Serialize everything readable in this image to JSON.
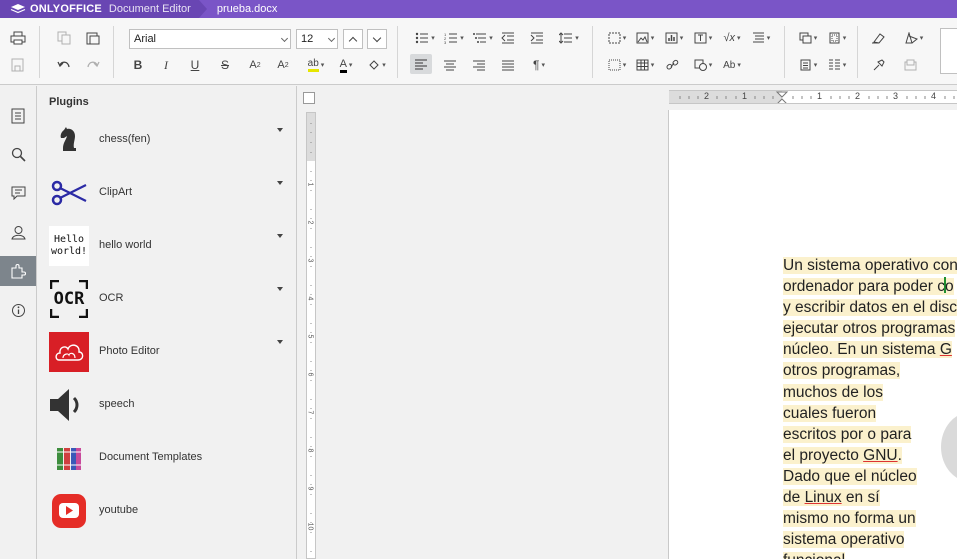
{
  "titlebar": {
    "brand": "ONLYOFFICE",
    "app": "Document Editor",
    "document": "prueba.docx",
    "color": "#7a55c7"
  },
  "toolbar": {
    "font_name": "Arial",
    "font_size": "12",
    "paragraph_mark": "¶",
    "clear_style": "Aa",
    "case_label": "Ab"
  },
  "sidebar": {
    "items": [
      {
        "icon": "document-icon"
      },
      {
        "icon": "search-icon"
      },
      {
        "icon": "comment-icon"
      },
      {
        "icon": "user-icon"
      },
      {
        "icon": "plugins-icon",
        "active": true
      },
      {
        "icon": "info-icon"
      }
    ]
  },
  "plugins": {
    "title": "Plugins",
    "items": [
      {
        "name": "chess(fen)",
        "icon": "chess-knight-icon",
        "has_menu": true
      },
      {
        "name": "ClipArt",
        "icon": "scissors-icon",
        "has_menu": true
      },
      {
        "name": "hello world",
        "icon": "hello-world-icon",
        "icon_text": "Hello\nworld!",
        "has_menu": true
      },
      {
        "name": "OCR",
        "icon": "ocr-icon",
        "icon_text": "OCR",
        "has_menu": true
      },
      {
        "name": "Photo Editor",
        "icon": "photo-editor-icon",
        "has_menu": true
      },
      {
        "name": "speech",
        "icon": "speaker-icon",
        "has_menu": false
      },
      {
        "name": "Document Templates",
        "icon": "templates-icon",
        "has_menu": false
      },
      {
        "name": "youtube",
        "icon": "youtube-icon",
        "has_menu": false
      }
    ]
  },
  "ruler": {
    "h_labels": [
      "2",
      "1",
      "1",
      "2",
      "3",
      "4"
    ],
    "v_labels": [
      "1",
      "2",
      "3",
      "4",
      "5",
      "6",
      "7",
      "8",
      "9",
      "10"
    ]
  },
  "document": {
    "lines": [
      "Un sistema operativo con",
      "ordenador para poder co",
      "y escribir datos en el disc",
      "ejecutar otros programas",
      "núcleo. En un sistema G",
      "otros programas,",
      "muchos de los",
      "cuales fueron",
      "escritos por o para",
      "el proyecto GNU.",
      "Dado que el núcleo",
      "de Linux en sí",
      "mismo no forma un",
      "sistema operativo",
      "funcional"
    ]
  }
}
